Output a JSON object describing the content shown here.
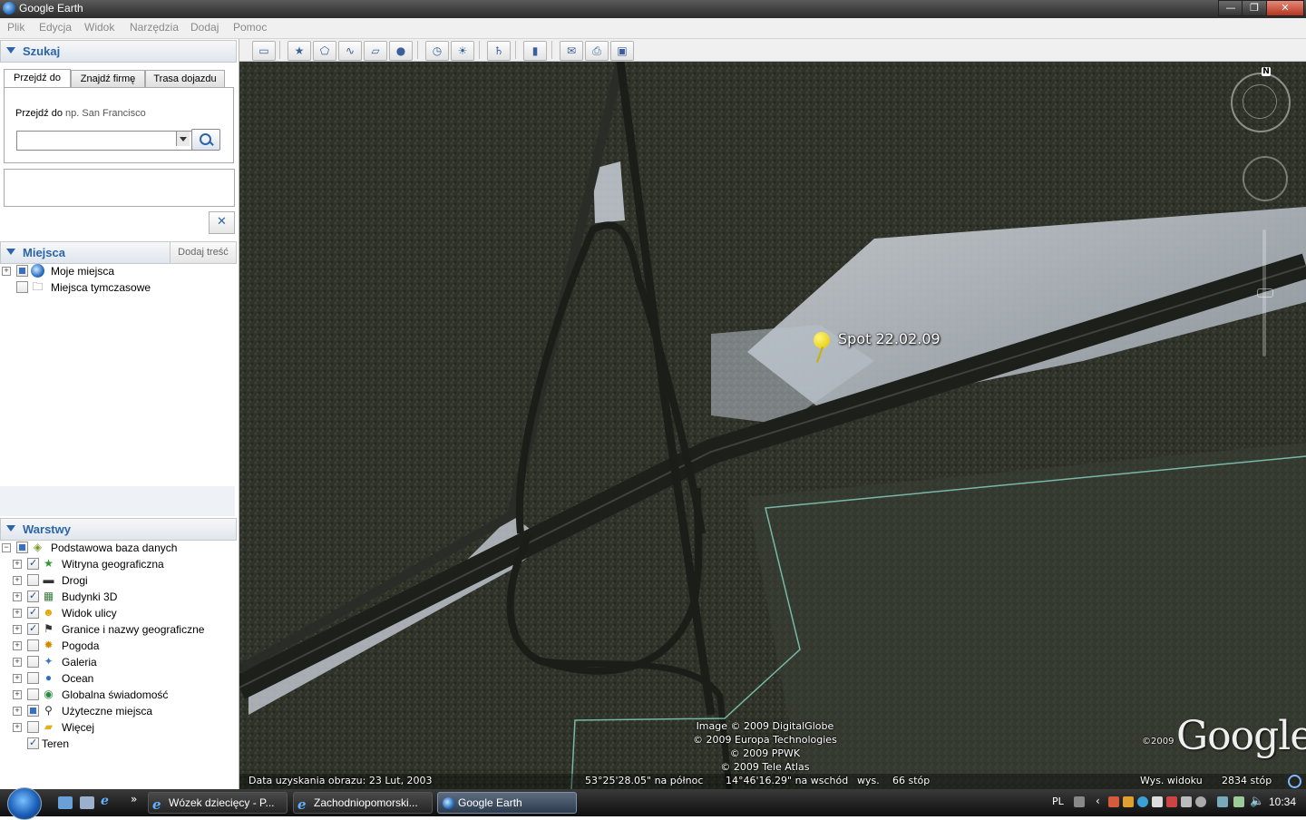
{
  "window": {
    "title": "Google Earth",
    "controls": [
      "—",
      "❐",
      "✕"
    ]
  },
  "menu": [
    "Plik",
    "Edycja",
    "Widok",
    "Narzędzia",
    "Dodaj",
    "Pomoc"
  ],
  "search": {
    "header": "Szukaj",
    "tabs": [
      "Przejdź do",
      "Znajdź firmę",
      "Trasa dojazdu"
    ],
    "hint_label": "Przejdź do",
    "hint_placeholder": "np. San Francisco",
    "input_value": "",
    "clear_label": "✕"
  },
  "places": {
    "header": "Miejsca",
    "add_content": "Dodaj treść",
    "items": [
      {
        "label": "Moje miejsca",
        "icon": "globe-icon"
      },
      {
        "label": "Miejsca tymczasowe",
        "icon": "folder-icon"
      }
    ]
  },
  "layers": {
    "header": "Warstwy",
    "root": "Podstawowa baza danych",
    "items": [
      {
        "label": "Witryna geograficzna",
        "checked": true,
        "icon": "star-icon"
      },
      {
        "label": "Drogi",
        "checked": false,
        "icon": "road-icon"
      },
      {
        "label": "Budynki 3D",
        "checked": true,
        "icon": "building-icon"
      },
      {
        "label": "Widok ulicy",
        "checked": true,
        "icon": "pegman-icon"
      },
      {
        "label": "Granice i nazwy geograficzne",
        "checked": true,
        "icon": "flag-icon"
      },
      {
        "label": "Pogoda",
        "checked": false,
        "icon": "sun-icon"
      },
      {
        "label": "Galeria",
        "checked": false,
        "icon": "gallery-star-icon"
      },
      {
        "label": "Ocean",
        "checked": false,
        "icon": "ocean-icon"
      },
      {
        "label": "Globalna świadomość",
        "checked": false,
        "icon": "earth-icon"
      },
      {
        "label": "Użyteczne miejsca",
        "checked": "partial",
        "icon": "pin-icon"
      },
      {
        "label": "Więcej",
        "checked": false,
        "icon": "folder-more-icon"
      },
      {
        "label": "Teren",
        "checked": true,
        "icon": ""
      }
    ]
  },
  "toolbar": {
    "buttons": [
      {
        "name": "sidebar-toggle-button",
        "glyph": "▭"
      },
      {
        "name": "add-placemark-button",
        "glyph": "★"
      },
      {
        "name": "add-polygon-button",
        "glyph": "⬠"
      },
      {
        "name": "add-path-button",
        "glyph": "∿"
      },
      {
        "name": "add-overlay-button",
        "glyph": "▱"
      },
      {
        "name": "record-tour-button",
        "glyph": "●"
      },
      {
        "name": "historical-imagery-button",
        "glyph": "◷"
      },
      {
        "name": "sunlight-button",
        "glyph": "☀"
      },
      {
        "name": "switch-sky-button",
        "glyph": "♄"
      },
      {
        "name": "ruler-button",
        "glyph": "▮"
      },
      {
        "name": "email-button",
        "glyph": "✉"
      },
      {
        "name": "print-button",
        "glyph": "⎙"
      },
      {
        "name": "save-image-button",
        "glyph": "▣"
      }
    ]
  },
  "map": {
    "placemark_label": "Spot 22.02.09",
    "credits": [
      "Image © 2009 DigitalGlobe",
      "© 2009 Europa Technologies",
      "© 2009 PPWK",
      "© 2009 Tele Atlas"
    ],
    "logo": "Google",
    "logo_year": "©2009",
    "compass_north": "N",
    "status": {
      "imagery_date": "Data uzyskania obrazu: 23 Lut, 2003",
      "lat": "53°25'28.05\" na północ",
      "lon": "14°46'16.29\" na wschód",
      "elev_label": "wys.",
      "elev_value": "66 stóp",
      "eye_label": "Wys. widoku",
      "eye_value": "2834 stóp"
    }
  },
  "taskbar": {
    "quick_launch_more": "»",
    "tasks": [
      {
        "label": "Wózek dziecięcy - P...",
        "icon": "ie-icon",
        "active": false
      },
      {
        "label": "Zachodniopomorski...",
        "icon": "ie-icon",
        "active": false
      },
      {
        "label": "Google Earth",
        "icon": "google-earth-icon",
        "active": true
      }
    ],
    "language": "PL",
    "clock": "10:34"
  }
}
